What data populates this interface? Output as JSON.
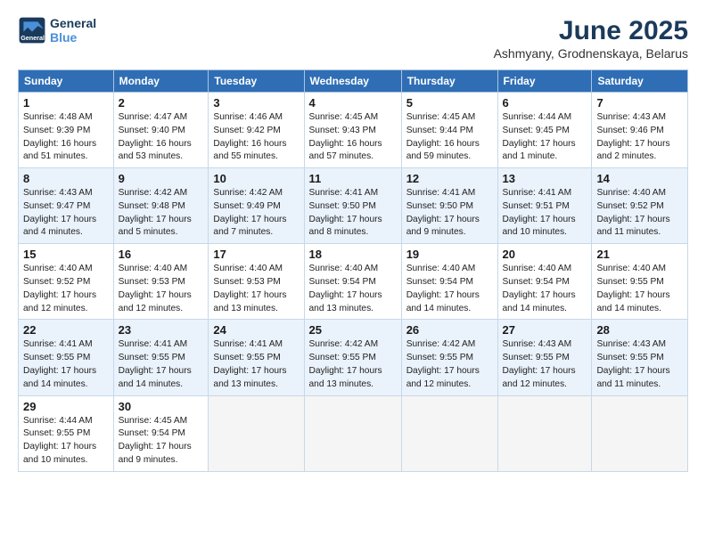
{
  "logo": {
    "line1": "General",
    "line2": "Blue"
  },
  "title": "June 2025",
  "subtitle": "Ashmyany, Grodnenskaya, Belarus",
  "weekdays": [
    "Sunday",
    "Monday",
    "Tuesday",
    "Wednesday",
    "Thursday",
    "Friday",
    "Saturday"
  ],
  "weeks": [
    [
      {
        "day": "1",
        "info": "Sunrise: 4:48 AM\nSunset: 9:39 PM\nDaylight: 16 hours\nand 51 minutes."
      },
      {
        "day": "2",
        "info": "Sunrise: 4:47 AM\nSunset: 9:40 PM\nDaylight: 16 hours\nand 53 minutes."
      },
      {
        "day": "3",
        "info": "Sunrise: 4:46 AM\nSunset: 9:42 PM\nDaylight: 16 hours\nand 55 minutes."
      },
      {
        "day": "4",
        "info": "Sunrise: 4:45 AM\nSunset: 9:43 PM\nDaylight: 16 hours\nand 57 minutes."
      },
      {
        "day": "5",
        "info": "Sunrise: 4:45 AM\nSunset: 9:44 PM\nDaylight: 16 hours\nand 59 minutes."
      },
      {
        "day": "6",
        "info": "Sunrise: 4:44 AM\nSunset: 9:45 PM\nDaylight: 17 hours\nand 1 minute."
      },
      {
        "day": "7",
        "info": "Sunrise: 4:43 AM\nSunset: 9:46 PM\nDaylight: 17 hours\nand 2 minutes."
      }
    ],
    [
      {
        "day": "8",
        "info": "Sunrise: 4:43 AM\nSunset: 9:47 PM\nDaylight: 17 hours\nand 4 minutes."
      },
      {
        "day": "9",
        "info": "Sunrise: 4:42 AM\nSunset: 9:48 PM\nDaylight: 17 hours\nand 5 minutes."
      },
      {
        "day": "10",
        "info": "Sunrise: 4:42 AM\nSunset: 9:49 PM\nDaylight: 17 hours\nand 7 minutes."
      },
      {
        "day": "11",
        "info": "Sunrise: 4:41 AM\nSunset: 9:50 PM\nDaylight: 17 hours\nand 8 minutes."
      },
      {
        "day": "12",
        "info": "Sunrise: 4:41 AM\nSunset: 9:50 PM\nDaylight: 17 hours\nand 9 minutes."
      },
      {
        "day": "13",
        "info": "Sunrise: 4:41 AM\nSunset: 9:51 PM\nDaylight: 17 hours\nand 10 minutes."
      },
      {
        "day": "14",
        "info": "Sunrise: 4:40 AM\nSunset: 9:52 PM\nDaylight: 17 hours\nand 11 minutes."
      }
    ],
    [
      {
        "day": "15",
        "info": "Sunrise: 4:40 AM\nSunset: 9:52 PM\nDaylight: 17 hours\nand 12 minutes."
      },
      {
        "day": "16",
        "info": "Sunrise: 4:40 AM\nSunset: 9:53 PM\nDaylight: 17 hours\nand 12 minutes."
      },
      {
        "day": "17",
        "info": "Sunrise: 4:40 AM\nSunset: 9:53 PM\nDaylight: 17 hours\nand 13 minutes."
      },
      {
        "day": "18",
        "info": "Sunrise: 4:40 AM\nSunset: 9:54 PM\nDaylight: 17 hours\nand 13 minutes."
      },
      {
        "day": "19",
        "info": "Sunrise: 4:40 AM\nSunset: 9:54 PM\nDaylight: 17 hours\nand 14 minutes."
      },
      {
        "day": "20",
        "info": "Sunrise: 4:40 AM\nSunset: 9:54 PM\nDaylight: 17 hours\nand 14 minutes."
      },
      {
        "day": "21",
        "info": "Sunrise: 4:40 AM\nSunset: 9:55 PM\nDaylight: 17 hours\nand 14 minutes."
      }
    ],
    [
      {
        "day": "22",
        "info": "Sunrise: 4:41 AM\nSunset: 9:55 PM\nDaylight: 17 hours\nand 14 minutes."
      },
      {
        "day": "23",
        "info": "Sunrise: 4:41 AM\nSunset: 9:55 PM\nDaylight: 17 hours\nand 14 minutes."
      },
      {
        "day": "24",
        "info": "Sunrise: 4:41 AM\nSunset: 9:55 PM\nDaylight: 17 hours\nand 13 minutes."
      },
      {
        "day": "25",
        "info": "Sunrise: 4:42 AM\nSunset: 9:55 PM\nDaylight: 17 hours\nand 13 minutes."
      },
      {
        "day": "26",
        "info": "Sunrise: 4:42 AM\nSunset: 9:55 PM\nDaylight: 17 hours\nand 12 minutes."
      },
      {
        "day": "27",
        "info": "Sunrise: 4:43 AM\nSunset: 9:55 PM\nDaylight: 17 hours\nand 12 minutes."
      },
      {
        "day": "28",
        "info": "Sunrise: 4:43 AM\nSunset: 9:55 PM\nDaylight: 17 hours\nand 11 minutes."
      }
    ],
    [
      {
        "day": "29",
        "info": "Sunrise: 4:44 AM\nSunset: 9:55 PM\nDaylight: 17 hours\nand 10 minutes."
      },
      {
        "day": "30",
        "info": "Sunrise: 4:45 AM\nSunset: 9:54 PM\nDaylight: 17 hours\nand 9 minutes."
      },
      null,
      null,
      null,
      null,
      null
    ]
  ]
}
